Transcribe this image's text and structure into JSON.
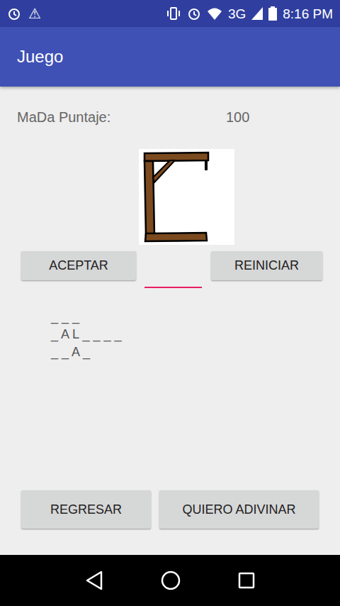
{
  "status_bar": {
    "time": "8:16 PM",
    "network": "3G",
    "warning": "⚠"
  },
  "app_bar": {
    "title": "Juego"
  },
  "score": {
    "label": "MaDa Puntaje:",
    "value": "100"
  },
  "hangman": {
    "errors": 0
  },
  "controls": {
    "accept": "ACEPTAR",
    "reset": "REINICIAR",
    "input_value": ""
  },
  "word_lines": [
    "_ _ _",
    "_ A L _ _ _ _",
    "_ _ A _"
  ],
  "bottom_buttons": [
    {
      "label": "REGRESAR"
    },
    {
      "label": "QUIERO ADIVINAR"
    }
  ]
}
